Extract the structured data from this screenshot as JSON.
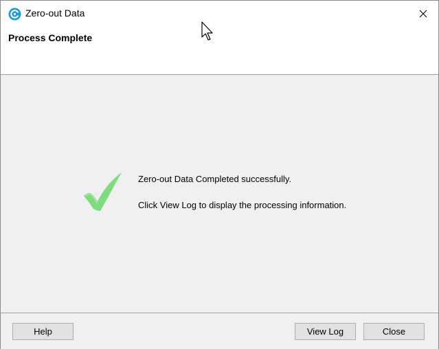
{
  "window": {
    "title": "Zero-out Data",
    "icon": "app-logo-icon",
    "close_icon": "close-icon"
  },
  "header": {
    "title": "Process Complete"
  },
  "content": {
    "status_icon": "checkmark-icon",
    "message_line1": "Zero-out Data Completed successfully.",
    "message_line2": "Click View Log to display the processing information."
  },
  "footer": {
    "help_label": "Help",
    "view_log_label": "View Log",
    "close_label": "Close"
  },
  "colors": {
    "accent": "#1e9bd7",
    "check": "#7ddc7d",
    "panel": "#f0f0f0"
  }
}
